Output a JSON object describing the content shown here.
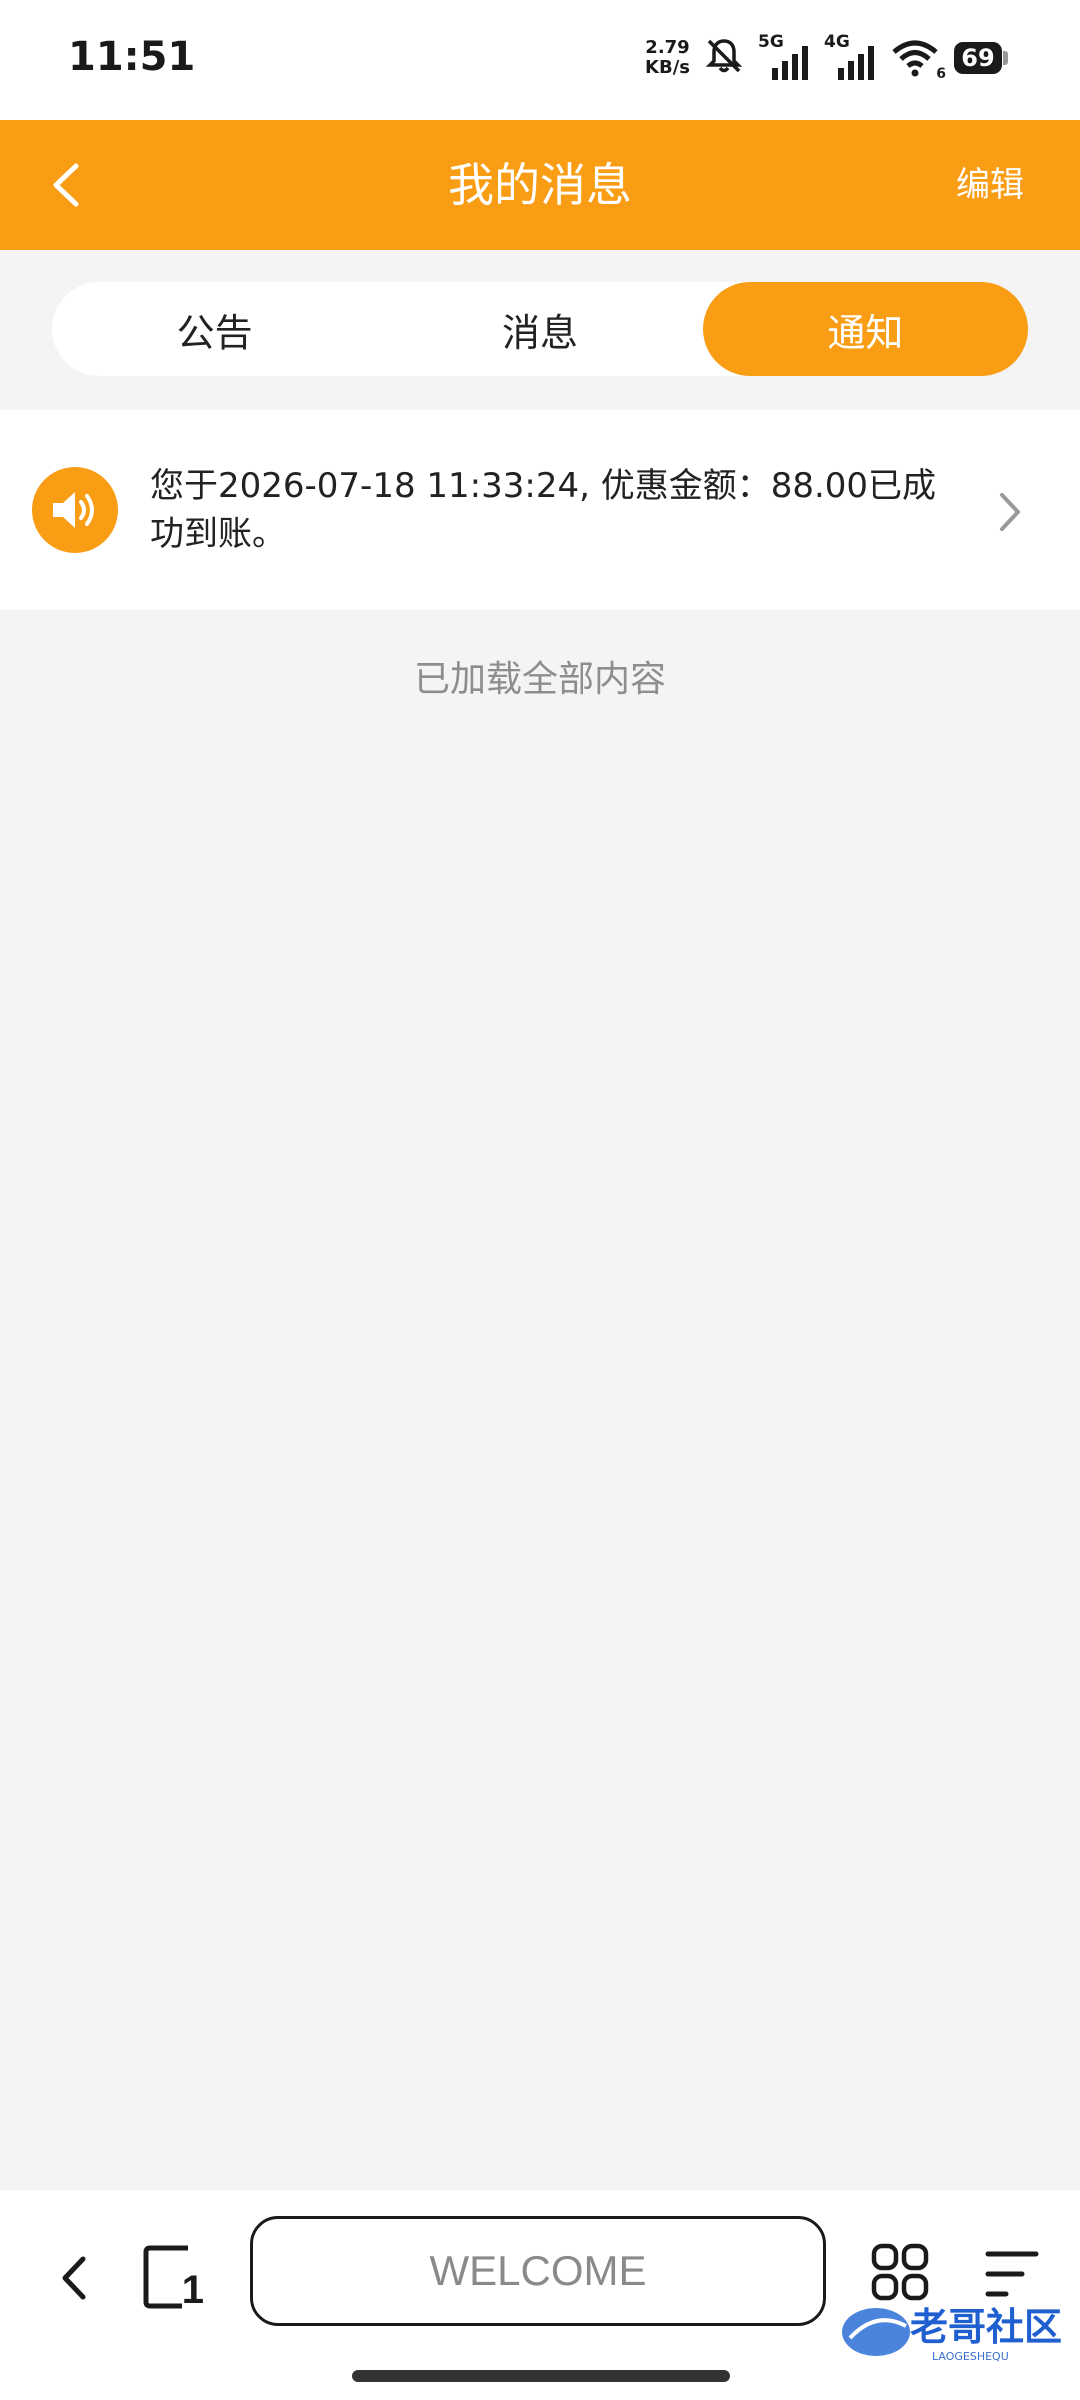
{
  "status_bar": {
    "time": "11:51",
    "net_speed_value": "2.79",
    "net_speed_unit": "KB/s",
    "sim1_label": "5G",
    "sim2_label": "4G",
    "wifi_badge": "6",
    "battery": "69"
  },
  "header": {
    "title": "我的消息",
    "edit_label": "编辑"
  },
  "tabs": [
    {
      "label": "公告",
      "active": false
    },
    {
      "label": "消息",
      "active": false
    },
    {
      "label": "通知",
      "active": true
    }
  ],
  "notifications": [
    {
      "icon": "speaker-icon",
      "text": "您于2026-07-18 11:33:24, 优惠金额：88.00已成功到账。"
    }
  ],
  "footer_status": "已加载全部内容",
  "browser_bar": {
    "address_text": "WELCOME",
    "tab_count": "1"
  },
  "watermark": {
    "text": "老哥社区",
    "sub": "LAOGESHEQU"
  },
  "colors": {
    "accent": "#f99d15",
    "background": "#f4f4f4"
  }
}
